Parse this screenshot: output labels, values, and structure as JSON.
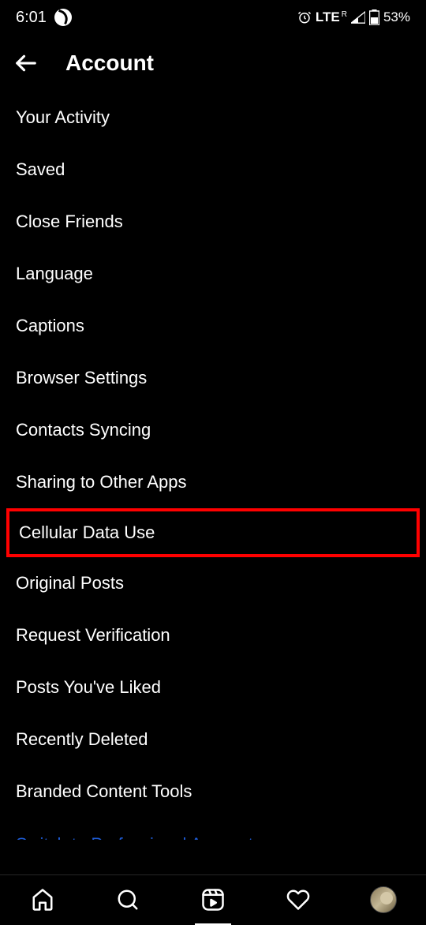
{
  "statusBar": {
    "time": "6:01",
    "network": "LTE",
    "networkSuper": "R",
    "battery": "53%"
  },
  "header": {
    "title": "Account"
  },
  "menuItems": [
    {
      "label": "Your Activity"
    },
    {
      "label": "Saved"
    },
    {
      "label": "Close Friends"
    },
    {
      "label": "Language"
    },
    {
      "label": "Captions"
    },
    {
      "label": "Browser Settings"
    },
    {
      "label": "Contacts Syncing"
    },
    {
      "label": "Sharing to Other Apps"
    },
    {
      "label": "Cellular Data Use"
    },
    {
      "label": "Original Posts"
    },
    {
      "label": "Request Verification"
    },
    {
      "label": "Posts You've Liked"
    },
    {
      "label": "Recently Deleted"
    },
    {
      "label": "Branded Content Tools"
    }
  ],
  "linkItem": {
    "label": "Switch to Professional Account"
  }
}
